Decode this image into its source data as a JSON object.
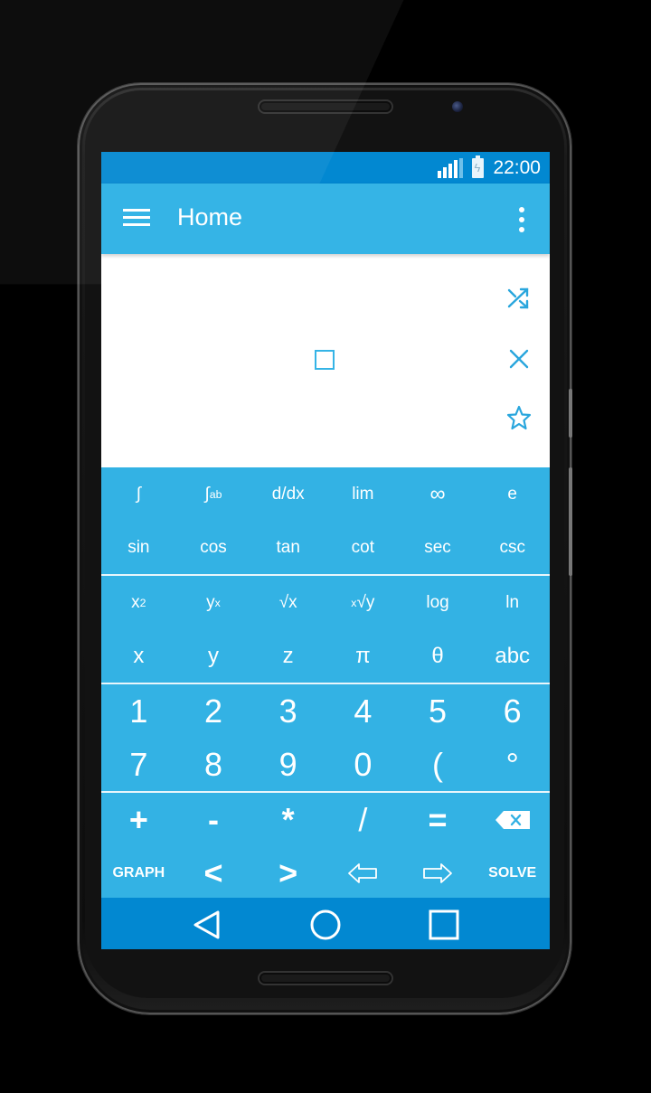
{
  "status_bar": {
    "time": "22:00",
    "signal_icon": "cellular-signal-icon",
    "battery_icon": "battery-charging-icon"
  },
  "app_bar": {
    "title": "Home",
    "menu_icon": "hamburger-menu-icon",
    "overflow_icon": "more-vert-icon"
  },
  "editor": {
    "placeholder_icon": "empty-input-box",
    "actions": [
      {
        "name": "shuffle",
        "icon": "shuffle-icon"
      },
      {
        "name": "clear",
        "icon": "close-icon"
      },
      {
        "name": "favorite",
        "icon": "star-outline-icon"
      }
    ],
    "accent_color": "#35b4e6"
  },
  "keypad": {
    "background_color": "#33b2e4",
    "rows": [
      [
        "∫",
        "∫ab",
        "d/dx",
        "lim",
        "∞",
        "e"
      ],
      [
        "sin",
        "cos",
        "tan",
        "cot",
        "sec",
        "csc"
      ],
      [
        "x2",
        "yx",
        "√x",
        "x√y",
        "log",
        "ln"
      ],
      [
        "x",
        "y",
        "z",
        "π",
        "θ",
        "abc"
      ],
      [
        "1",
        "2",
        "3",
        "4",
        "5",
        "6"
      ],
      [
        "7",
        "8",
        "9",
        "0",
        "(",
        "°"
      ],
      [
        "+",
        "-",
        "*",
        "/",
        "=",
        "backspace"
      ],
      [
        "GRAPH",
        "<",
        ">",
        "cursor-left",
        "cursor-right",
        "SOLVE"
      ]
    ],
    "labels": {
      "integral": "∫",
      "def_integral_base": "∫",
      "def_integral_lower": "a",
      "def_integral_upper": "b",
      "derivative": "d/dx",
      "limit": "lim",
      "infinity": "∞",
      "euler": "e",
      "sin": "sin",
      "cos": "cos",
      "tan": "tan",
      "cot": "cot",
      "sec": "sec",
      "csc": "csc",
      "square_base": "x",
      "square_exp": "2",
      "power_base": "y",
      "power_exp": "x",
      "sqrt": "√x",
      "nroot_index": "x",
      "nroot_body": "√y",
      "log": "log",
      "ln": "ln",
      "var_x": "x",
      "var_y": "y",
      "var_z": "z",
      "pi": "π",
      "theta": "θ",
      "abc": "abc",
      "d1": "1",
      "d2": "2",
      "d3": "3",
      "d4": "4",
      "d5": "5",
      "d6": "6",
      "d7": "7",
      "d8": "8",
      "d9": "9",
      "d0": "0",
      "paren": "(",
      "degree": "°",
      "plus": "+",
      "minus": "-",
      "times": "*",
      "divide": "/",
      "equals": "=",
      "backspace_icon": "backspace-icon",
      "graph": "GRAPH",
      "less": "<",
      "greater": ">",
      "cursor_left_icon": "arrow-left-outline-icon",
      "cursor_right_icon": "arrow-right-outline-icon",
      "solve": "SOLVE"
    }
  },
  "nav_bar": {
    "back_icon": "back-triangle-icon",
    "home_icon": "home-circle-icon",
    "recents_icon": "recents-square-icon",
    "color": "#0288d1"
  }
}
